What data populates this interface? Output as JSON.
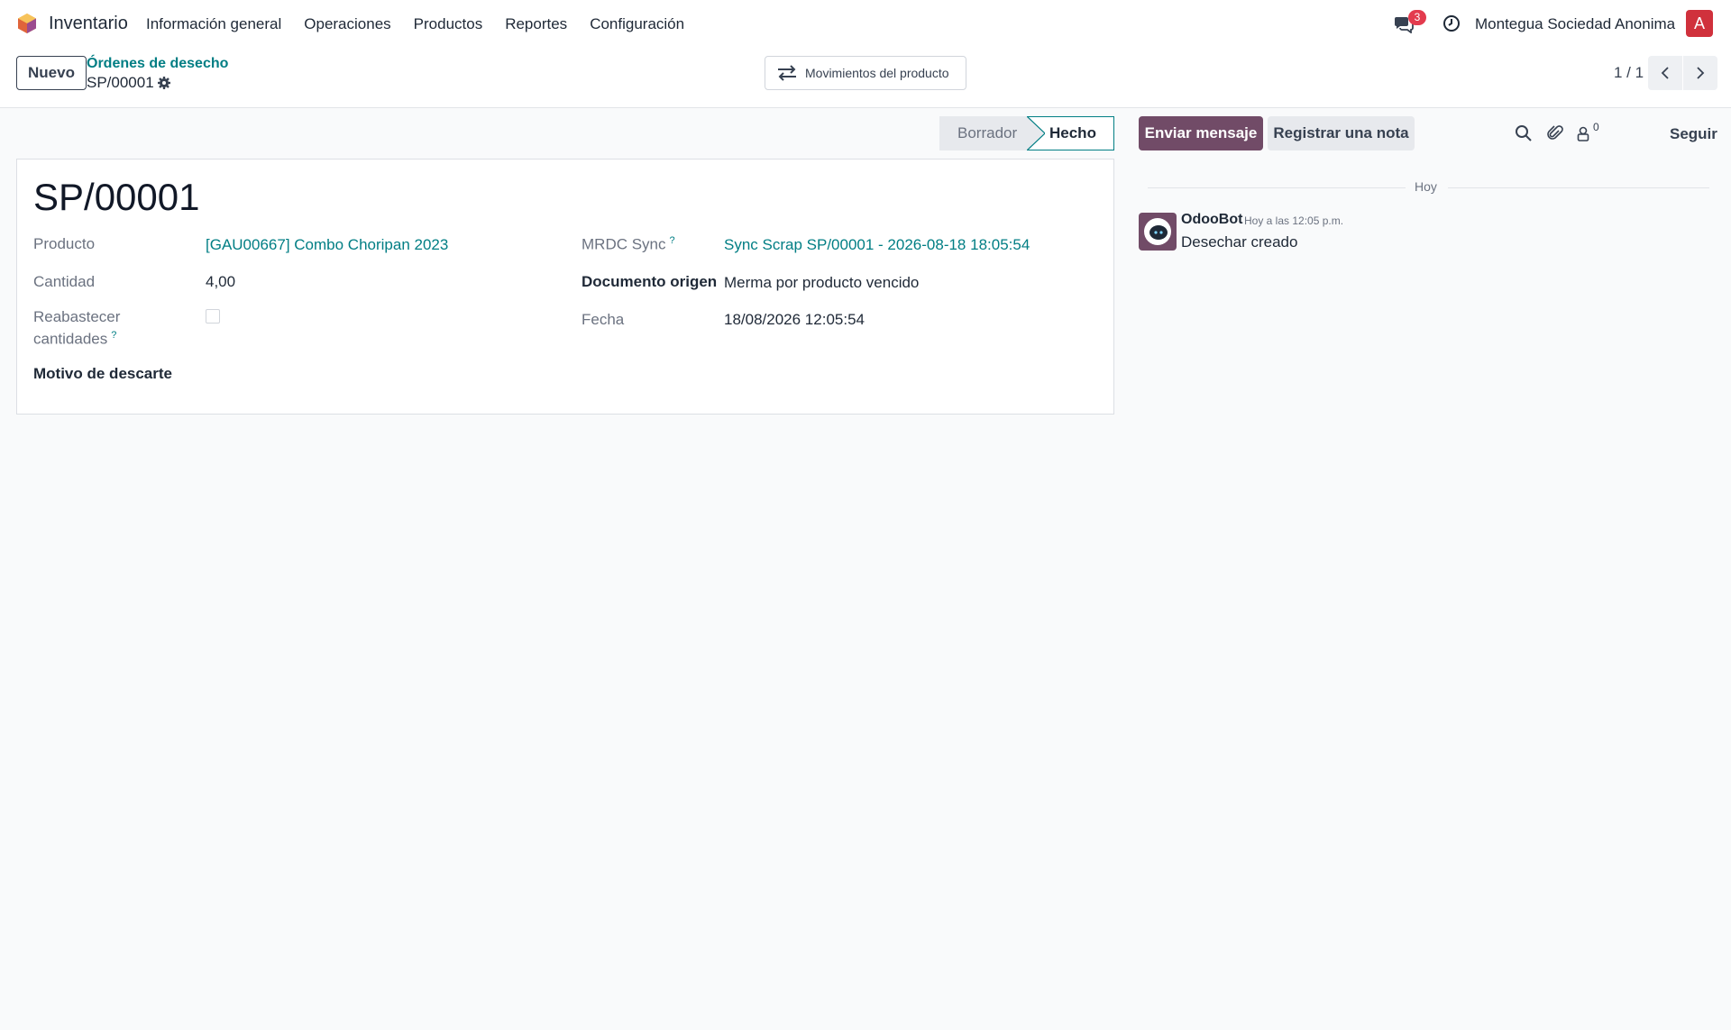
{
  "navbar": {
    "app_name": "Inventario",
    "menu": [
      "Información general",
      "Operaciones",
      "Productos",
      "Reportes",
      "Configuración"
    ],
    "messages_badge": "3",
    "company": "Montegua Sociedad Anonima",
    "avatar_letter": "A",
    "avatar_color": "#d0313c"
  },
  "control_panel": {
    "new_label": "Nuevo",
    "breadcrumb": "Órdenes de desecho",
    "record": "SP/00001",
    "smart_button": "Movimientos del producto",
    "pager": "1 / 1"
  },
  "statusbar": {
    "stages": [
      "Borrador",
      "Hecho"
    ],
    "current": "Hecho"
  },
  "form": {
    "title": "SP/00001",
    "fields": {
      "product_label": "Producto",
      "product_value": "[GAU00667] Combo Choripan 2023",
      "quantity_label": "Cantidad",
      "quantity_value": "4,00",
      "replenish_label_1": "Reabastecer",
      "replenish_label_2": "cantidades",
      "replenish_help": "?",
      "reason_label": "Motivo de descarte",
      "mrdc_label": "MRDC Sync",
      "mrdc_help": "?",
      "mrdc_value": "Sync Scrap SP/00001 - 2026-08-18 18:05:54",
      "origin_label": "Documento origen",
      "origin_value": "Merma por producto vencido",
      "date_label": "Fecha",
      "date_value": "18/08/2026 12:05:54"
    }
  },
  "chatter": {
    "send_label": "Enviar mensaje",
    "note_label": "Registrar una nota",
    "followers_count": "0",
    "follow_label": "Seguir",
    "separator": "Hoy",
    "message": {
      "author": "OdooBot",
      "time": "Hoy a las 12:05 p.m.",
      "body": "Desechar creado"
    }
  },
  "colors": {
    "primary": "#714b67",
    "link": "#017e84"
  }
}
